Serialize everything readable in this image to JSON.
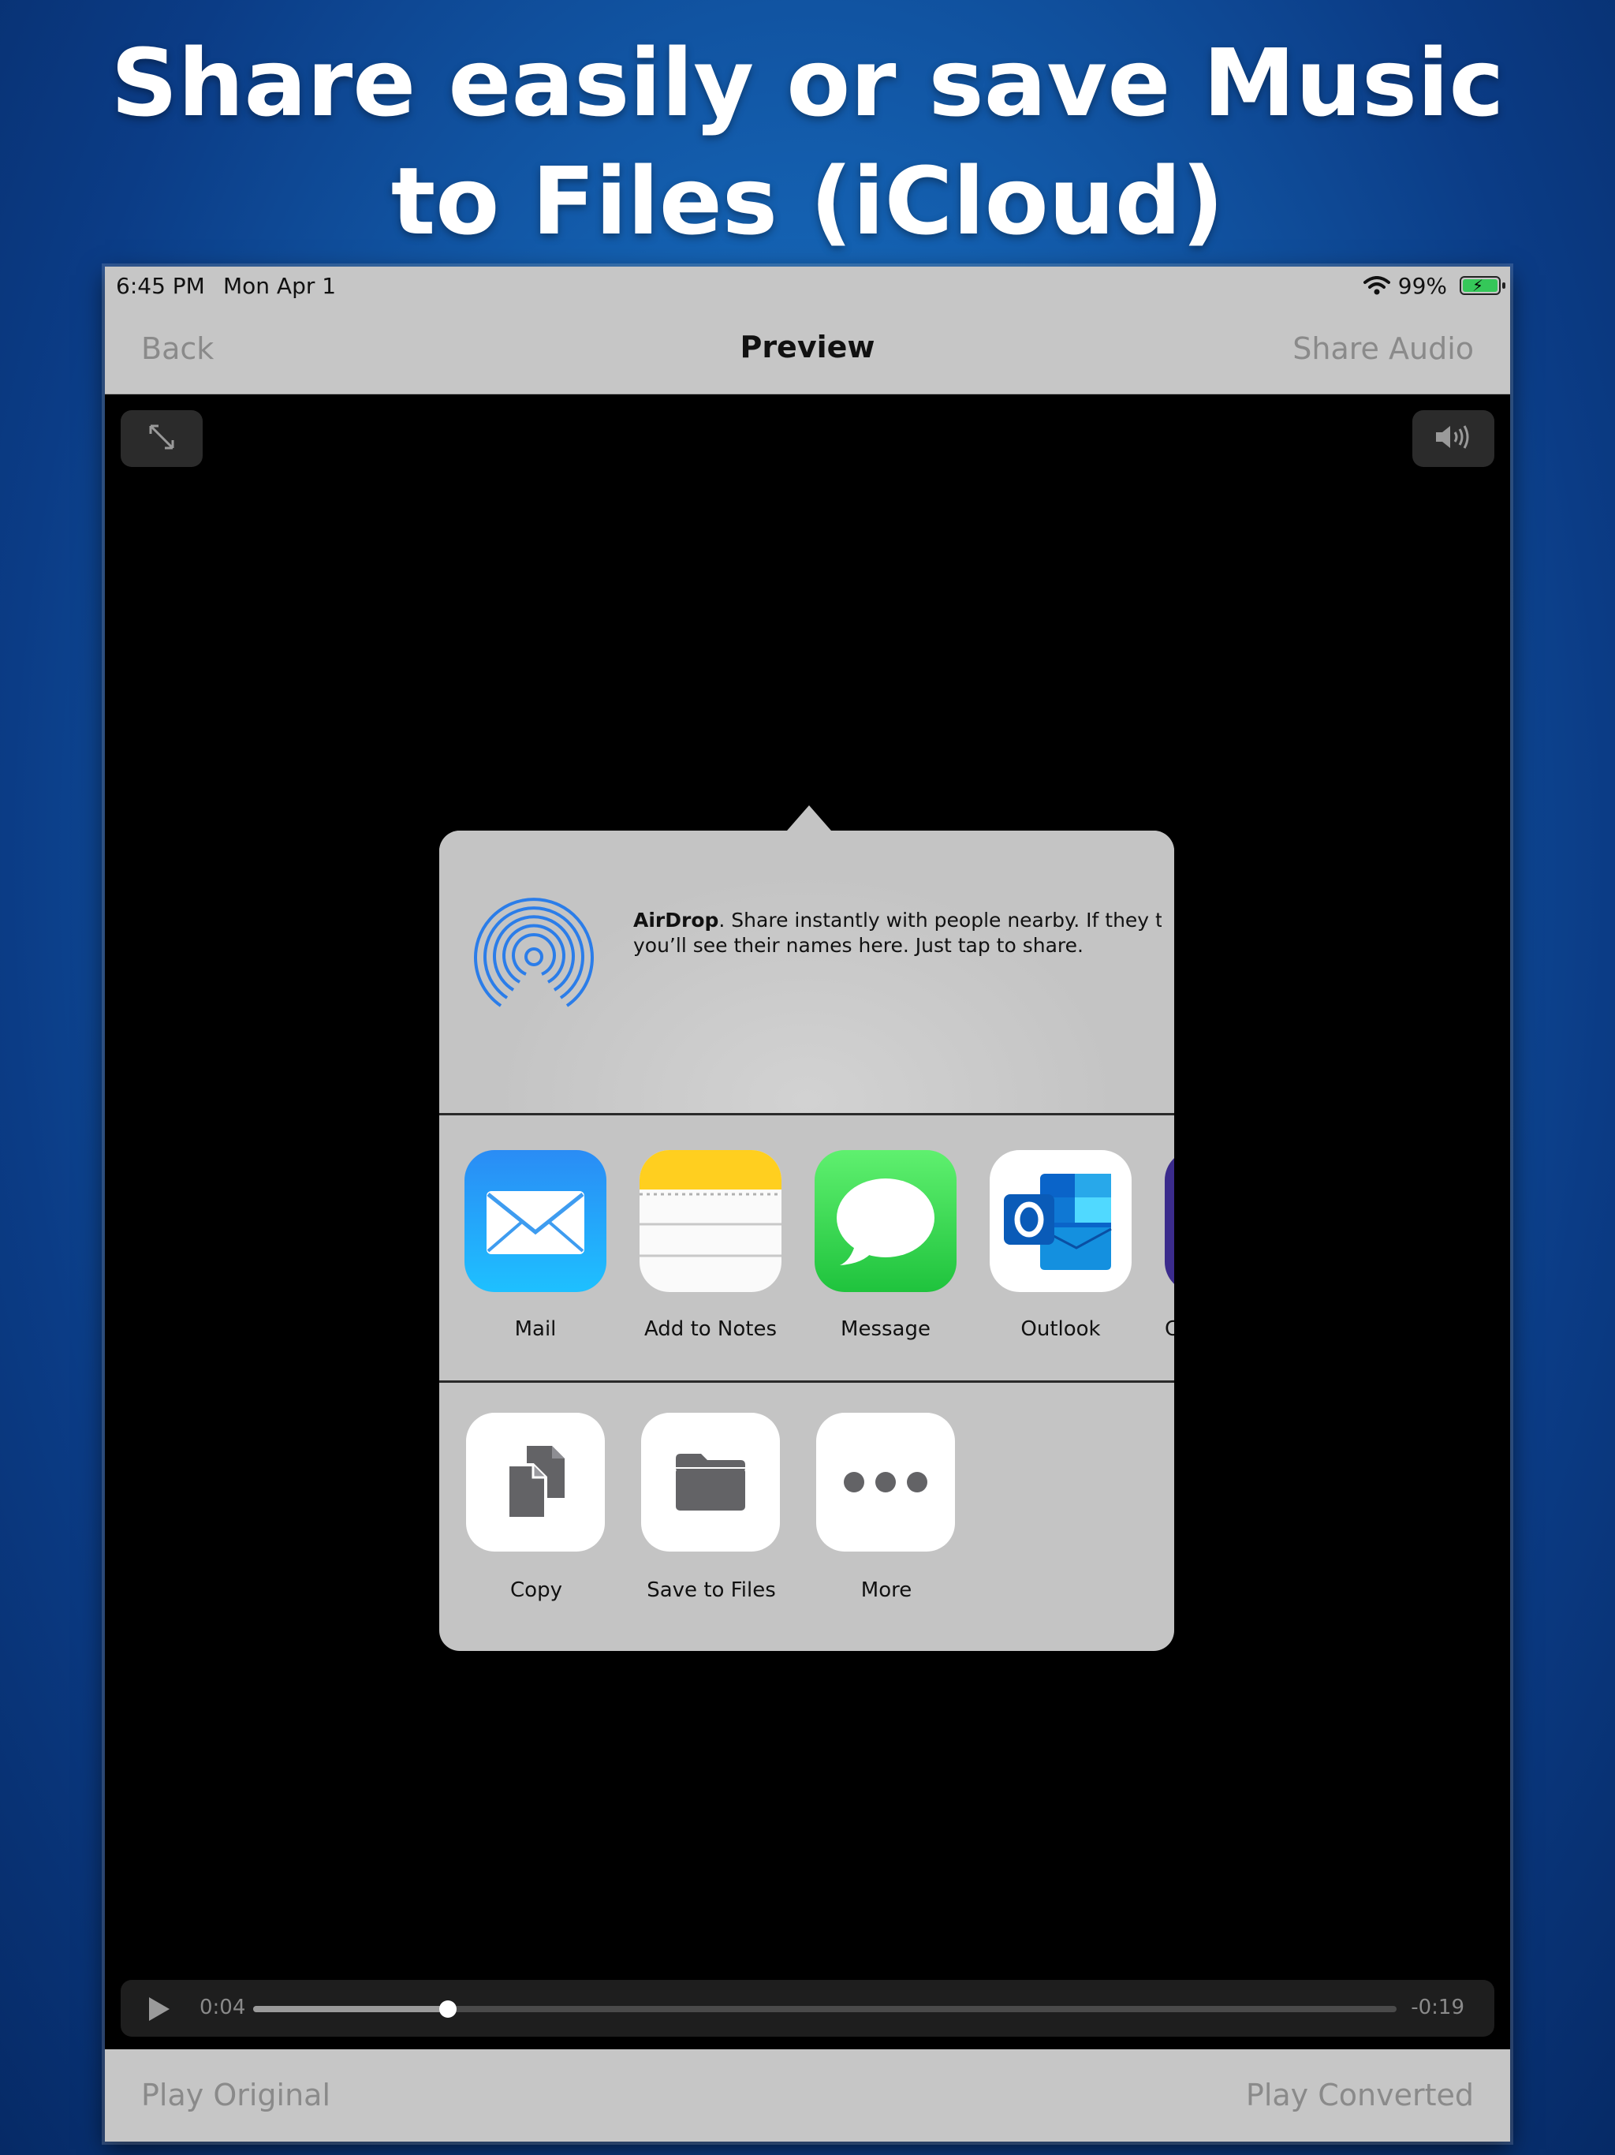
{
  "headline": {
    "line1": "Share easily or save Music",
    "line2": "to Files (iCloud)"
  },
  "status_bar": {
    "time": "6:45 PM",
    "date": "Mon Apr 1",
    "battery": "99%",
    "battery_level": 0.99,
    "charging": true
  },
  "nav": {
    "back": "Back",
    "title": "Preview",
    "share": "Share Audio"
  },
  "share_sheet": {
    "airdrop": {
      "title": "AirDrop",
      "text": ". Share instantly with people nearby. If they tu",
      "text2": "you’ll see their names here. Just tap to share."
    },
    "apps": [
      {
        "label": "Mail",
        "icon": "mail-icon"
      },
      {
        "label": "Add to Notes",
        "icon": "notes-icon"
      },
      {
        "label": "Message",
        "icon": "message-icon"
      },
      {
        "label": "Outlook",
        "icon": "outlook-icon"
      },
      {
        "label": "C",
        "icon": "partial-app-icon"
      }
    ],
    "actions": [
      {
        "label": "Copy",
        "icon": "copy-icon"
      },
      {
        "label": "Save to Files",
        "icon": "folder-icon"
      },
      {
        "label": "More",
        "icon": "more-icon"
      }
    ]
  },
  "player": {
    "elapsed": "0:04",
    "remaining": "-0:19",
    "progress": 0.17
  },
  "bottom_bar": {
    "left": "Play Original",
    "right": "Play Converted"
  },
  "colors": {
    "background": "#1460b0",
    "bar": "#c6c6c6",
    "sheet": "#c4c4c4",
    "airdrop_blue": "#2b7de9",
    "message_green": "#34c759",
    "notes_yellow": "#ffd60a",
    "mail_blue": "#1a8cff",
    "outlook_blue": "#0a64c9"
  }
}
